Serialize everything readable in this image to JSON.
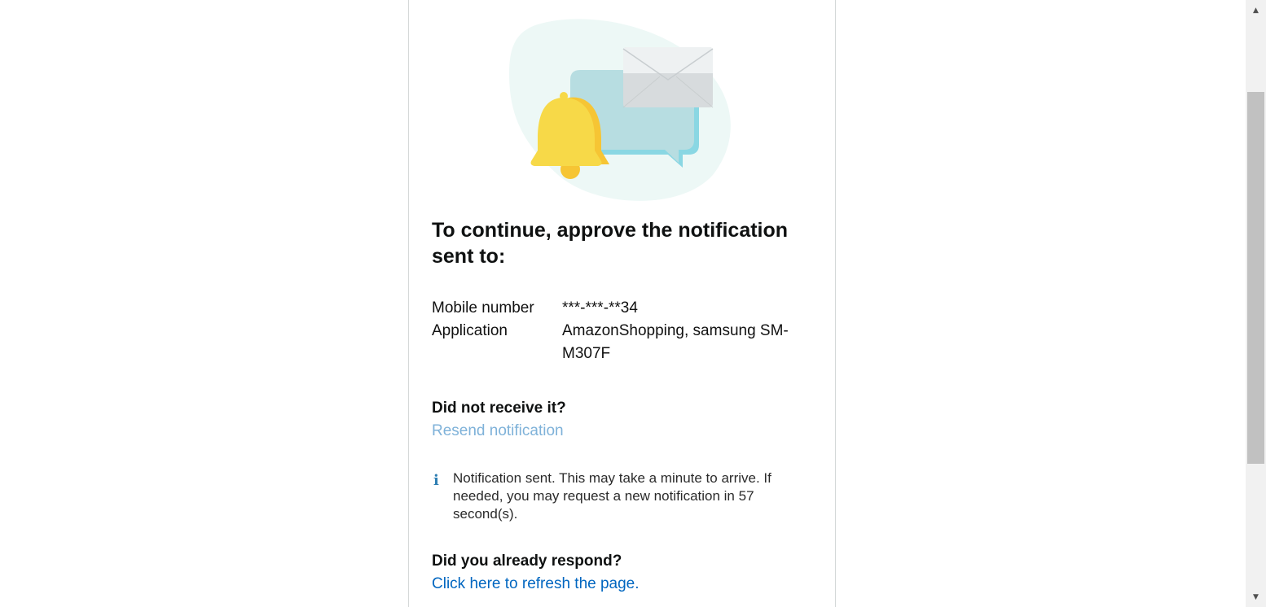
{
  "heading": "To continue, approve the notification sent to:",
  "details": [
    {
      "label": "Mobile number",
      "value": "***-***-**34"
    },
    {
      "label": "Application",
      "value": "AmazonShopping, samsung SM-M307F"
    }
  ],
  "resend": {
    "title": "Did not receive it?",
    "link": "Resend notification"
  },
  "notice": {
    "icon": "info-icon",
    "glyph": "i",
    "text": "Notification sent. This may take a minute to arrive. If needed, you may request a new notification in 57 second(s)."
  },
  "refresh": {
    "title": "Did you already respond?",
    "link": "Click here to refresh the page."
  },
  "scrollbar": {
    "up_glyph": "▲",
    "down_glyph": "▼"
  },
  "colors": {
    "resend_link_disabled": "#7fb2d9",
    "link": "#0066c0",
    "bell": "#f7d948",
    "bubble": "#b7dde1",
    "envelope": "#e6eaeb",
    "blob": "#edf8f6"
  }
}
